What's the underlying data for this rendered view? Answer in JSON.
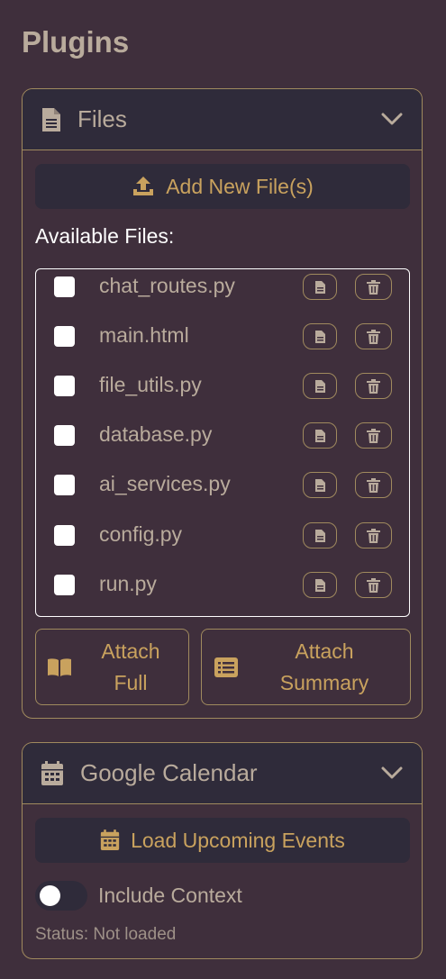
{
  "page_title": "Plugins",
  "colors": {
    "background": "#3f2f3c",
    "panel_header": "#2f2b3a",
    "border": "#a08a5e",
    "accent": "#c9a25e",
    "text": "#b9ab9c"
  },
  "files_panel": {
    "title": "Files",
    "icon": "file-icon",
    "add_button_label": "Add New File(s)",
    "available_label": "Available Files:",
    "files": [
      {
        "name": "chat_routes.py",
        "checked": false
      },
      {
        "name": "main.html",
        "checked": false
      },
      {
        "name": "file_utils.py",
        "checked": false
      },
      {
        "name": "database.py",
        "checked": false
      },
      {
        "name": "ai_services.py",
        "checked": false
      },
      {
        "name": "config.py",
        "checked": false
      },
      {
        "name": "run.py",
        "checked": false
      }
    ],
    "attach_full": {
      "line1": "Attach",
      "line2": "Full",
      "icon": "book-icon"
    },
    "attach_summary": {
      "line1": "Attach",
      "line2": "Summary",
      "icon": "list-icon"
    }
  },
  "calendar_panel": {
    "title": "Google Calendar",
    "icon": "calendar-icon",
    "load_button_label": "Load Upcoming Events",
    "include_context_label": "Include Context",
    "include_context_enabled": false,
    "status_text": "Status: Not loaded"
  }
}
